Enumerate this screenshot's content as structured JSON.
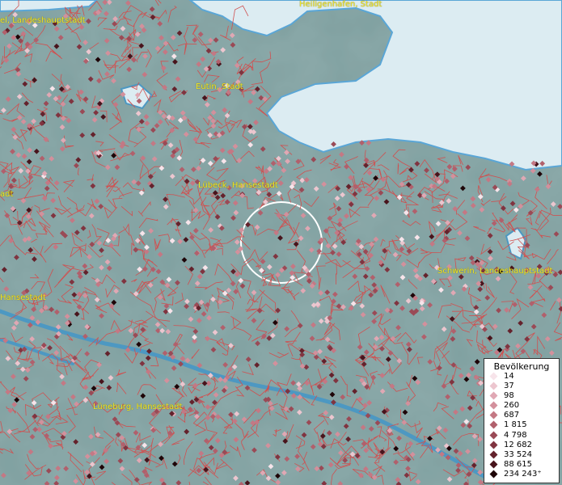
{
  "map": {
    "cities": [
      {
        "label": "Heiligenhafen, Stadt"
      },
      {
        "label": "el, Landeshauptstadt"
      },
      {
        "label": "Eutin, Stadt"
      },
      {
        "label": "Lübeck, Hansestadt"
      },
      {
        "label": "adt"
      },
      {
        "label": "Schwerin, Landeshauptstadt"
      },
      {
        "label": "Hansestadt"
      },
      {
        "label": "Lüneburg, Hansestadt"
      }
    ],
    "colors": {
      "land": "#7fa0a0",
      "sea": "#dcecf2",
      "river": "#4d98c2",
      "boundary": "#d05050",
      "highlight_circle": "#ffffff"
    }
  },
  "legend": {
    "title": "Bevölkerung",
    "classes": [
      {
        "value": "14",
        "color": "#f7e4ea"
      },
      {
        "value": "37",
        "color": "#ecc6cf"
      },
      {
        "value": "98",
        "color": "#e0a8b4"
      },
      {
        "value": "260",
        "color": "#d3909c"
      },
      {
        "value": "687",
        "color": "#c47884"
      },
      {
        "value": "1 815",
        "color": "#b1606c"
      },
      {
        "value": "4 798",
        "color": "#9a4a56"
      },
      {
        "value": "12 682",
        "color": "#803440"
      },
      {
        "value": "33 524",
        "color": "#64222c"
      },
      {
        "value": "88 615",
        "color": "#48141c"
      },
      {
        "value": "234 243⁺",
        "color": "#1e0508"
      }
    ]
  }
}
